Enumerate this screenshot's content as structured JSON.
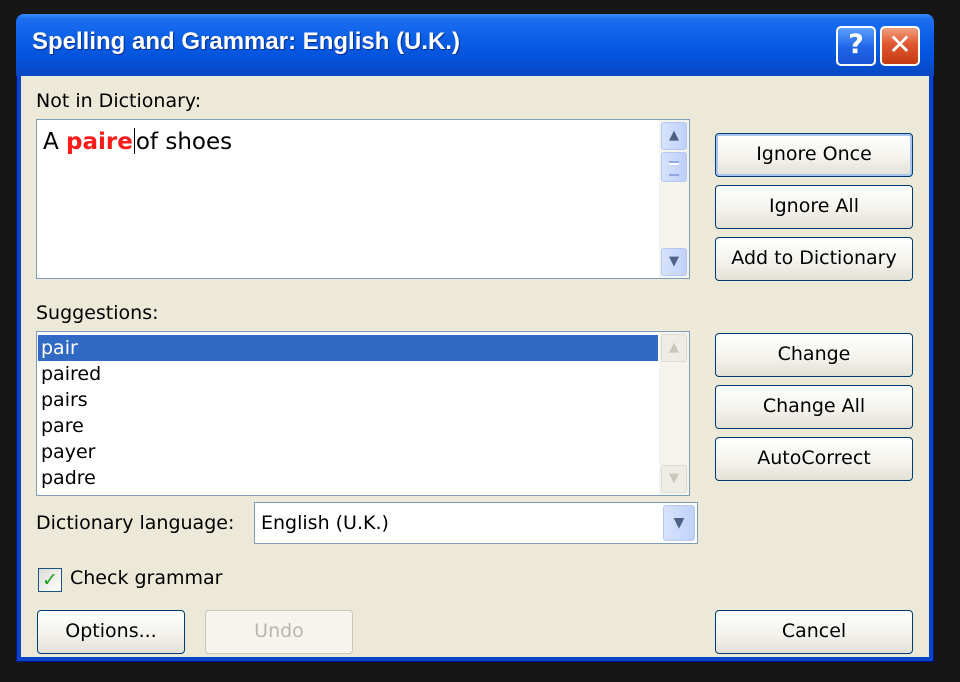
{
  "window": {
    "title": "Spelling and Grammar: English (U.K.)",
    "help_glyph": "?",
    "close_glyph": "✕"
  },
  "not_in_dictionary": {
    "label": "Not in Dictionary:",
    "sentence_before": "A ",
    "error_word": "paire",
    "sentence_after": "of shoes"
  },
  "suggestions": {
    "label": "Suggestions:",
    "items": [
      "pair",
      "paired",
      "pairs",
      "pare",
      "payer",
      "padre"
    ],
    "selected_index": 0
  },
  "dictionary_language": {
    "label": "Dictionary language:",
    "value": "English (U.K.)"
  },
  "check_grammar": {
    "label": "Check grammar",
    "checked": true
  },
  "buttons": {
    "ignore_once": "Ignore Once",
    "ignore_all": "Ignore All",
    "add_to_dictionary": "Add to Dictionary",
    "change": "Change",
    "change_all": "Change All",
    "autocorrect": "AutoCorrect",
    "options": "Options...",
    "undo": "Undo",
    "cancel": "Cancel"
  },
  "icons": {
    "scroll_up": "▲",
    "scroll_down": "▼",
    "dropdown": "▼",
    "check": "✓"
  },
  "colors": {
    "title_bar": "#0a5fe6",
    "dialog_face": "#ece9d8",
    "selection": "#316ac5",
    "error_word": "#ff1a1a"
  }
}
